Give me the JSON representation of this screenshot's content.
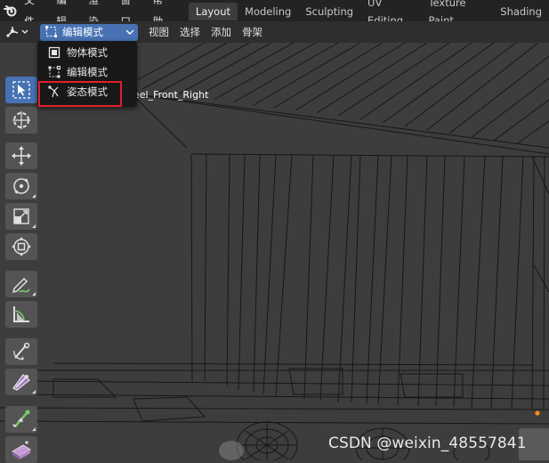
{
  "topbar": {
    "menus": [
      "文件",
      "编辑",
      "渲染",
      "窗口",
      "帮助"
    ],
    "workspace_tabs": [
      "Layout",
      "Modeling",
      "Sculpting",
      "UV Editing",
      "Texture Paint",
      "Shading"
    ],
    "active_tab": "Layout"
  },
  "header": {
    "editor_type_icon": "3d-viewport-icon",
    "mode_select": "编辑模式",
    "menus": [
      "视图",
      "选择",
      "添加",
      "骨架"
    ]
  },
  "mode_dropdown": {
    "items": [
      {
        "label": "物体模式",
        "icon": "object-mode-icon"
      },
      {
        "label": "编辑模式",
        "icon": "edit-mode-icon"
      },
      {
        "label": "姿态模式",
        "icon": "pose-mode-icon"
      }
    ],
    "highlighted": "姿态模式"
  },
  "viewport": {
    "object_name": "eel_Front_Right"
  },
  "toolbar": {
    "tools": [
      "select-box-icon",
      "cursor-icon",
      "move-icon",
      "rotate-icon",
      "scale-icon",
      "transform-icon",
      "annotate-icon",
      "measure-icon",
      "bone-roll-icon",
      "bone-size-icon",
      "extrude-icon",
      "shear-icon"
    ]
  },
  "colors": {
    "accent": "#4772b3",
    "highlight_box": "#e0202a",
    "topbar_bg": "#232323",
    "viewport_bg": "#3d3d3d"
  },
  "watermark": "CSDN @weixin_48557841"
}
